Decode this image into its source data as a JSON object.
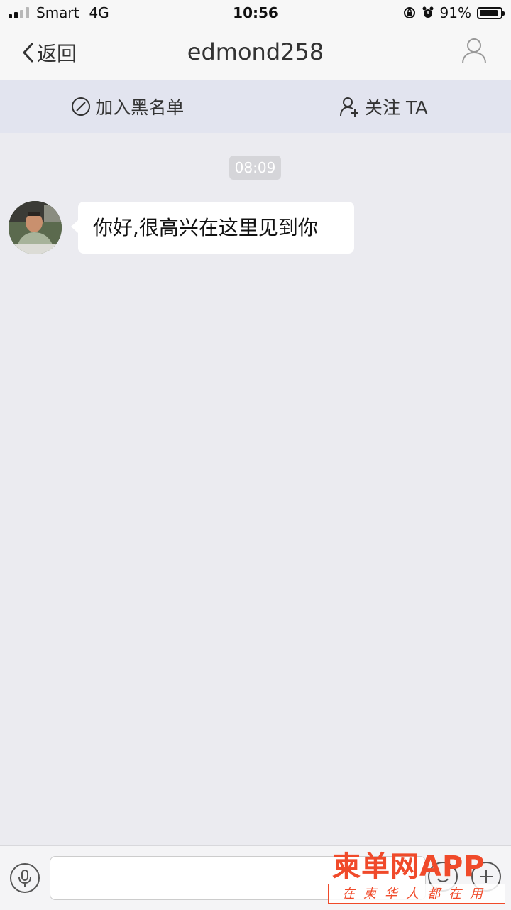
{
  "status_bar": {
    "carrier": "Smart",
    "network": "4G",
    "time": "10:56",
    "battery_percent_text": "91%",
    "battery_level": 0.91
  },
  "nav": {
    "back_label": "返回",
    "title": "edmond258"
  },
  "actions": {
    "block_label": "加入黑名单",
    "follow_label": "关注 TA"
  },
  "chat": {
    "timestamp": "08:09",
    "messages": [
      {
        "sender": "edmond258",
        "text": "你好,很高兴在这里见到你"
      }
    ]
  },
  "input": {
    "placeholder": ""
  },
  "watermark": {
    "brand": "柬单网APP",
    "slogan": "在柬华人都在用"
  },
  "colors": {
    "background": "#ebebf0",
    "action_bar": "#e2e4ef",
    "watermark": "#f04a2a"
  }
}
